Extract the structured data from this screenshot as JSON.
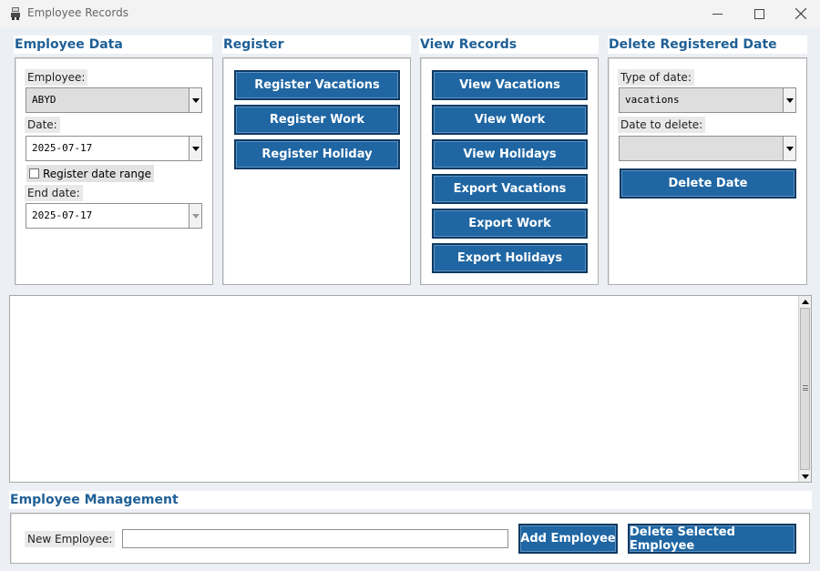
{
  "window": {
    "title": "Employee Records",
    "app_icon": "employee-figure-icon"
  },
  "window_controls": {
    "minimize": "minimize-icon",
    "maximize": "maximize-icon",
    "close": "close-icon"
  },
  "employee_data": {
    "title": "Employee Data",
    "employee_label": "Employee:",
    "employee_value": "ABYD",
    "date_label": "Date:",
    "date_value": "2025-07-17",
    "range_label": "Register date range",
    "range_checked": false,
    "end_date_label": "End date:",
    "end_date_value": "2025-07-17"
  },
  "register": {
    "title": "Register",
    "buttons": [
      "Register Vacations",
      "Register Work",
      "Register Holiday"
    ]
  },
  "view_records": {
    "title": "View Records",
    "buttons": [
      "View Vacations",
      "View Work",
      "View Holidays",
      "Export Vacations",
      "Export Work",
      "Export Holidays"
    ]
  },
  "delete_date": {
    "title": "Delete Registered Date",
    "type_label": "Type of date:",
    "type_value": "vacations",
    "date_label": "Date to delete:",
    "date_value": "",
    "button": "Delete Date"
  },
  "output": {
    "text": ""
  },
  "management": {
    "title": "Employee Management",
    "new_label": "New Employee:",
    "new_value": "",
    "add_button": "Add Employee",
    "delete_button": "Delete Selected Employee"
  },
  "colors": {
    "accent": "#1f66a3",
    "accent_border": "#0e3a62",
    "heading": "#1f5f96",
    "background": "#eceff4"
  }
}
